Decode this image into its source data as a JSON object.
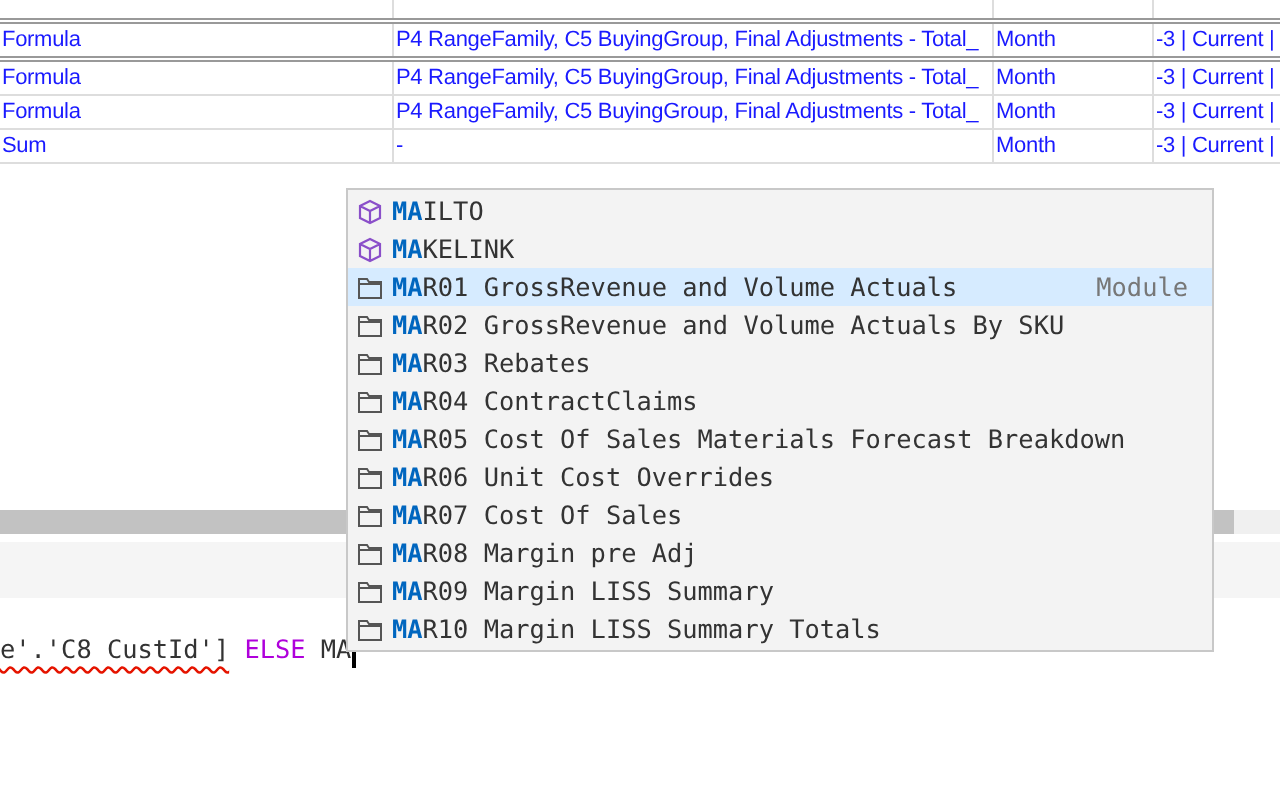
{
  "table": {
    "rows": [
      {
        "cells": [
          "Formula",
          "P4 RangeFamily, C5 BuyingGroup, Final Adjustments - Total_",
          "Month",
          "-3 | Current |"
        ],
        "emphasized": true
      },
      {
        "cells": [
          "Formula",
          "P4 RangeFamily, C5 BuyingGroup, Final Adjustments - Total_",
          "Month",
          "-3 | Current |"
        ],
        "emphasized": false
      },
      {
        "cells": [
          "Formula",
          "P4 RangeFamily, C5 BuyingGroup, Final Adjustments - Total_",
          "Month",
          "-3 | Current |"
        ],
        "emphasized": false
      },
      {
        "cells": [
          "Sum",
          "-",
          "Month",
          "-3 | Current |"
        ],
        "emphasized": false
      }
    ]
  },
  "editor": {
    "code": [
      {
        "text": "e'.'C8 CustId']",
        "kind": "error"
      },
      {
        "text": "ELSE",
        "kind": "keyword"
      },
      {
        "text": "MA",
        "kind": "plain"
      }
    ]
  },
  "suggestions": [
    {
      "match": "MA",
      "rest": "ILTO",
      "kind": "function",
      "selected": false
    },
    {
      "match": "MA",
      "rest": "KELINK",
      "kind": "function",
      "selected": false
    },
    {
      "match": "MA",
      "rest": "R01 GrossRevenue and Volume Actuals",
      "kind": "module",
      "selected": true,
      "detail": "Module"
    },
    {
      "match": "MA",
      "rest": "R02 GrossRevenue and Volume Actuals By SKU",
      "kind": "module",
      "selected": false
    },
    {
      "match": "MA",
      "rest": "R03 Rebates",
      "kind": "module",
      "selected": false
    },
    {
      "match": "MA",
      "rest": "R04 ContractClaims",
      "kind": "module",
      "selected": false
    },
    {
      "match": "MA",
      "rest": "R05 Cost Of Sales Materials Forecast Breakdown",
      "kind": "module",
      "selected": false
    },
    {
      "match": "MA",
      "rest": "R06 Unit Cost Overrides",
      "kind": "module",
      "selected": false
    },
    {
      "match": "MA",
      "rest": "R07 Cost Of Sales",
      "kind": "module",
      "selected": false
    },
    {
      "match": "MA",
      "rest": "R08 Margin pre Adj",
      "kind": "module",
      "selected": false
    },
    {
      "match": "MA",
      "rest": "R09 Margin LISS Summary",
      "kind": "module",
      "selected": false
    },
    {
      "match": "MA",
      "rest": "R10 Margin LISS Summary Totals",
      "kind": "module",
      "selected": false
    }
  ]
}
